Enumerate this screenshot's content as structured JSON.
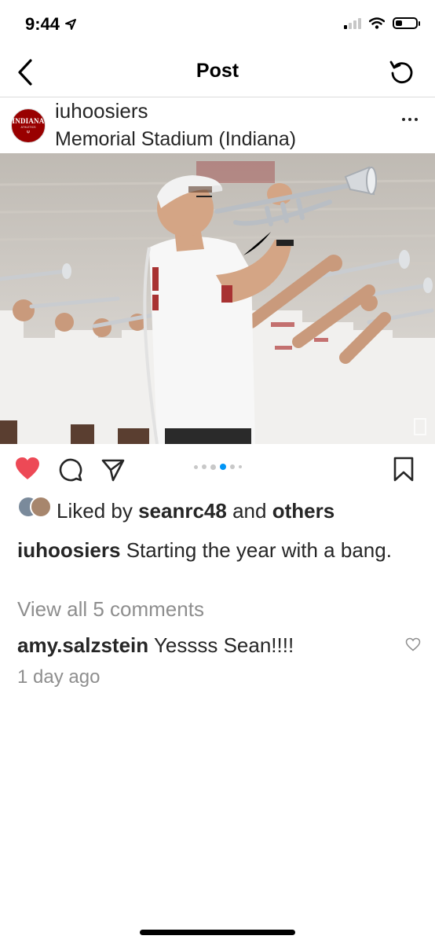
{
  "status_bar": {
    "time": "9:44",
    "icons": [
      "location-arrow-icon",
      "cellular-signal-icon",
      "wifi-icon",
      "battery-icon"
    ]
  },
  "nav": {
    "title": "Post",
    "back_icon": "chevron-left-icon",
    "refresh_icon": "refresh-icon"
  },
  "post": {
    "username": "iuhoosiers",
    "location": "Memorial Stadium (Indiana)",
    "avatar_text": "INDIANA",
    "avatar_subtext": "ATHLETICS",
    "more_icon": "more-horizontal-icon",
    "photo": {
      "subject": "Marching band trumpet players in white t-shirts playing in a stadium"
    },
    "carousel": {
      "count": 6,
      "active_index": 3
    },
    "actions": {
      "like_icon": "heart-filled-icon",
      "comment_icon": "comment-icon",
      "share_icon": "paper-plane-icon",
      "save_icon": "bookmark-icon",
      "liked": true
    },
    "likes": {
      "prefix": "Liked by",
      "user": "seanrc48",
      "joiner": "and",
      "others": "others"
    },
    "caption": {
      "username": "iuhoosiers",
      "text": "Starting the year with a bang."
    },
    "view_comments": "View all 5 comments",
    "comment": {
      "username": "amy.salzstein",
      "text": "Yessss Sean!!!!"
    },
    "timestamp": "1 day ago"
  },
  "colors": {
    "like_red": "#ed4956",
    "carousel_active": "#0095f6",
    "indiana_crimson": "#990000",
    "muted_text": "#8e8e8e"
  }
}
